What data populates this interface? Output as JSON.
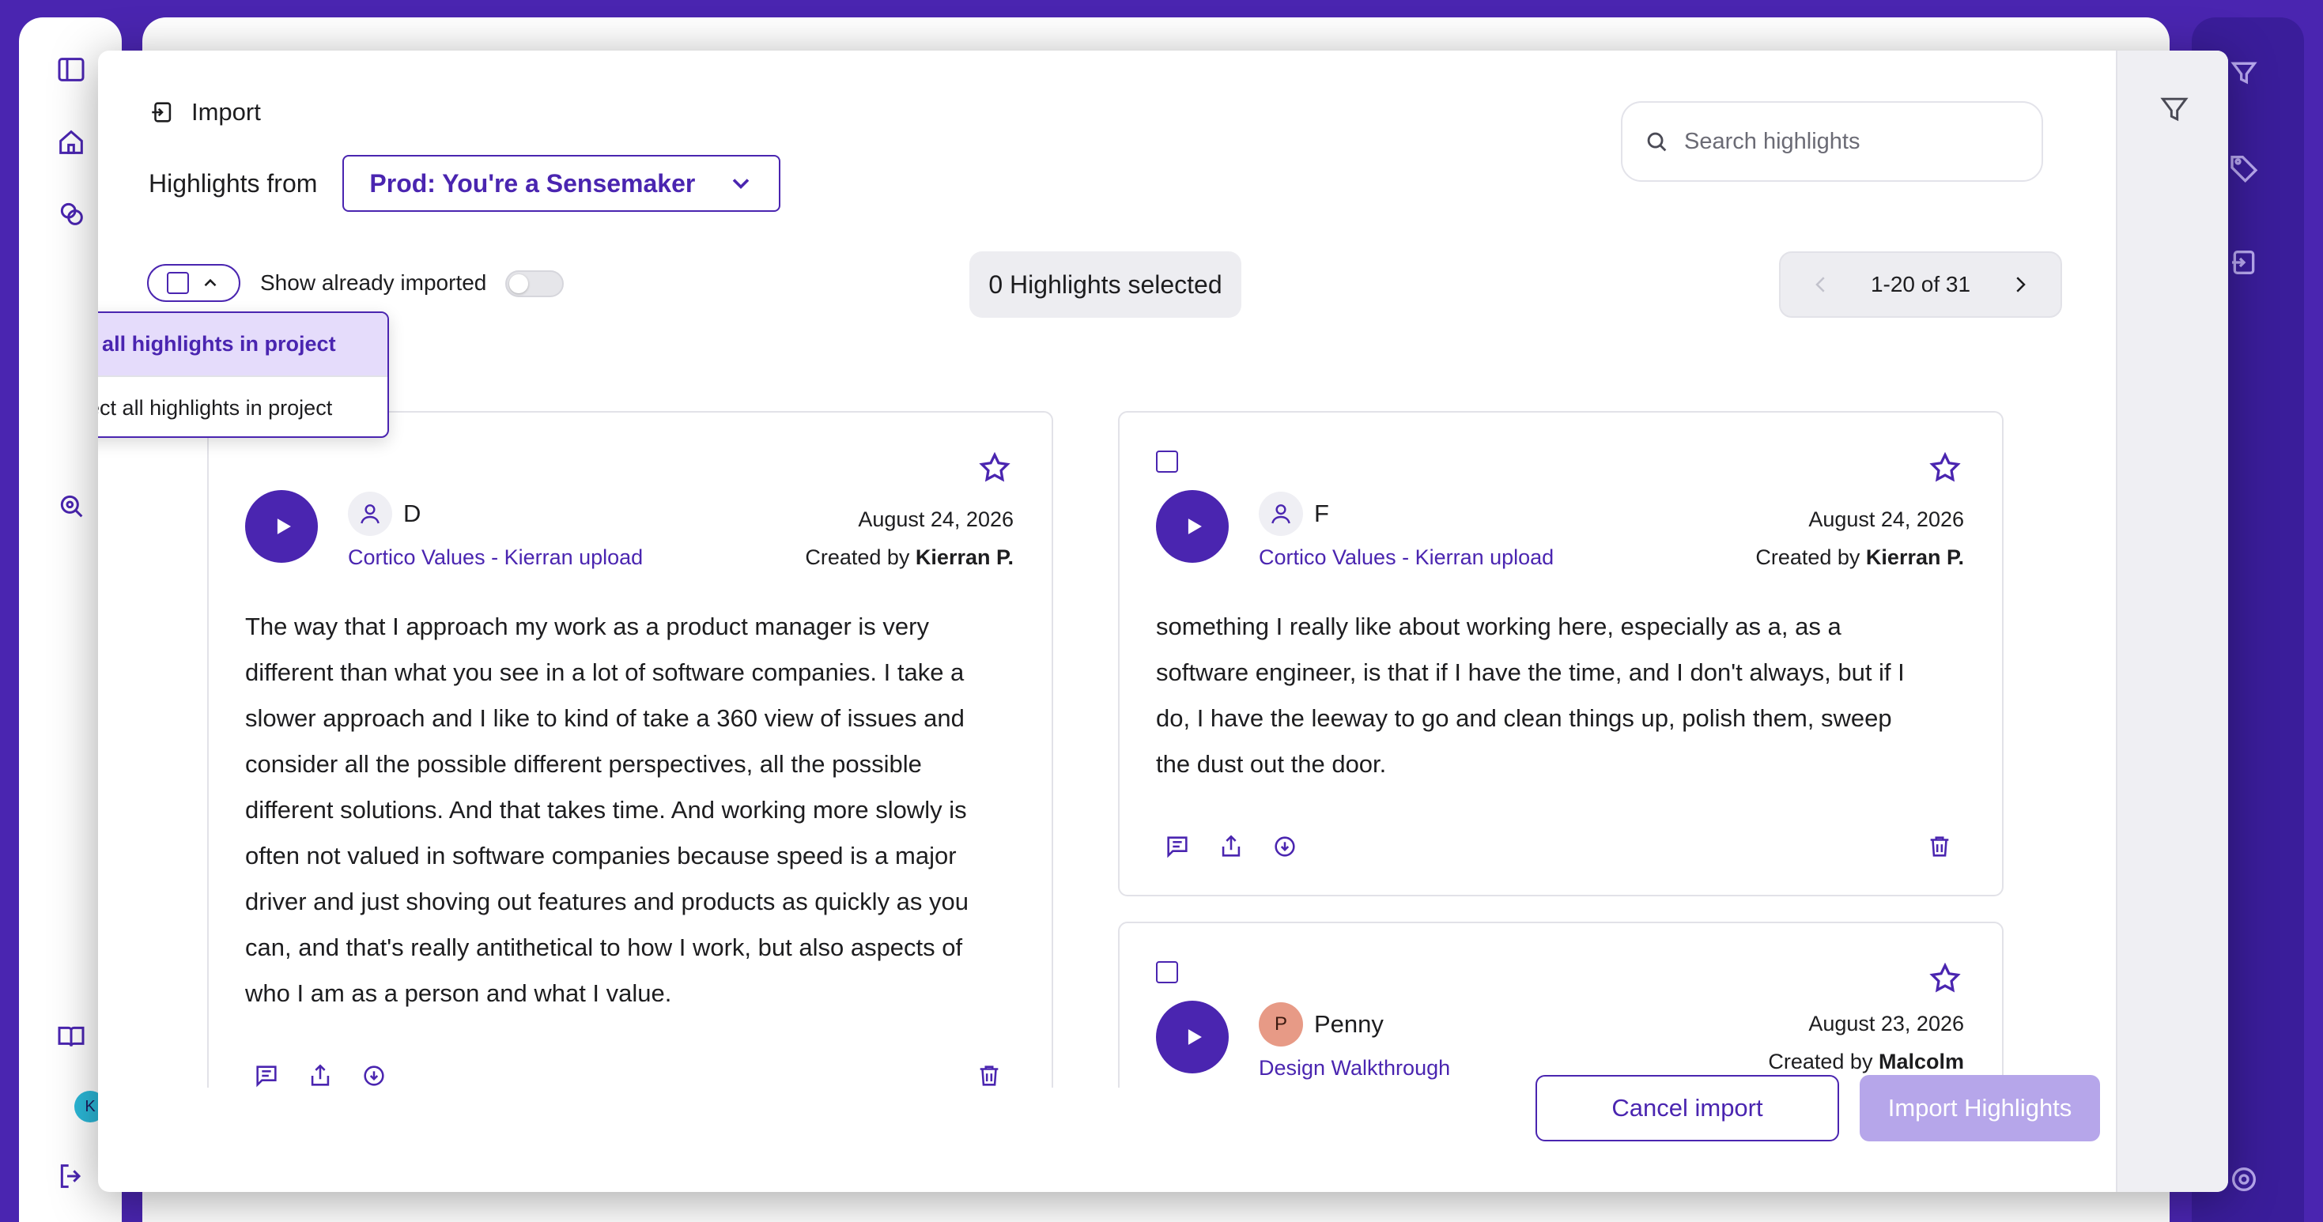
{
  "colors": {
    "accent": "#4a25b0",
    "accent_light": "#b6a6ea",
    "menu_active": "#e5dcfb"
  },
  "background": {
    "avatar_initial": "K"
  },
  "modal": {
    "title": "Import",
    "from_label": "Highlights from",
    "project": "Prod: You're a Sensemaker",
    "search_placeholder": "Search highlights",
    "show_imported_label": "Show already imported",
    "show_imported_on": false,
    "selected_count": "0 Highlights selected",
    "pagination": "1-20 of 31",
    "select_menu": {
      "items": [
        "Select all highlights in project",
        "Deselect all highlights in project"
      ]
    },
    "cards": [
      {
        "speaker": "D",
        "source": "Cortico Values - Kierran upload",
        "date": "August 24, 2026",
        "created_by_label": "Created by",
        "creator": "Kierran P.",
        "lines": [
          "The way that I approach my work as a product manager is very",
          "different than what you see in a lot of software companies. I take a",
          "slower approach and I like to kind of take a 360 view of issues and",
          "consider all the possible different perspectives, all the possible",
          "different solutions. And that takes time. And working more slowly is",
          "often not valued in software companies because speed is a major",
          "driver and just shoving out features and products as quickly as you",
          "can, and that's really antithetical to how I work, but also aspects of",
          "who I am as a person and what I value."
        ]
      },
      {
        "speaker": "F",
        "source": "Cortico Values - Kierran upload",
        "date": "August 24, 2026",
        "created_by_label": "Created by",
        "creator": "Kierran P.",
        "lines": [
          "something I really like about working here, especially as a, as a",
          "software engineer, is that if I have the time, and I don't always, but if I",
          "do, I have the leeway to go and clean things up, polish them, sweep",
          "the dust out the door."
        ]
      },
      {
        "speaker": "Penny",
        "speaker_initial": "P",
        "source": "Design Walkthrough",
        "date": "August 23, 2026",
        "created_by_label": "Created by",
        "creator": "Malcolm Projects"
      }
    ],
    "cancel_label": "Cancel import",
    "import_label": "Import Highlights"
  }
}
